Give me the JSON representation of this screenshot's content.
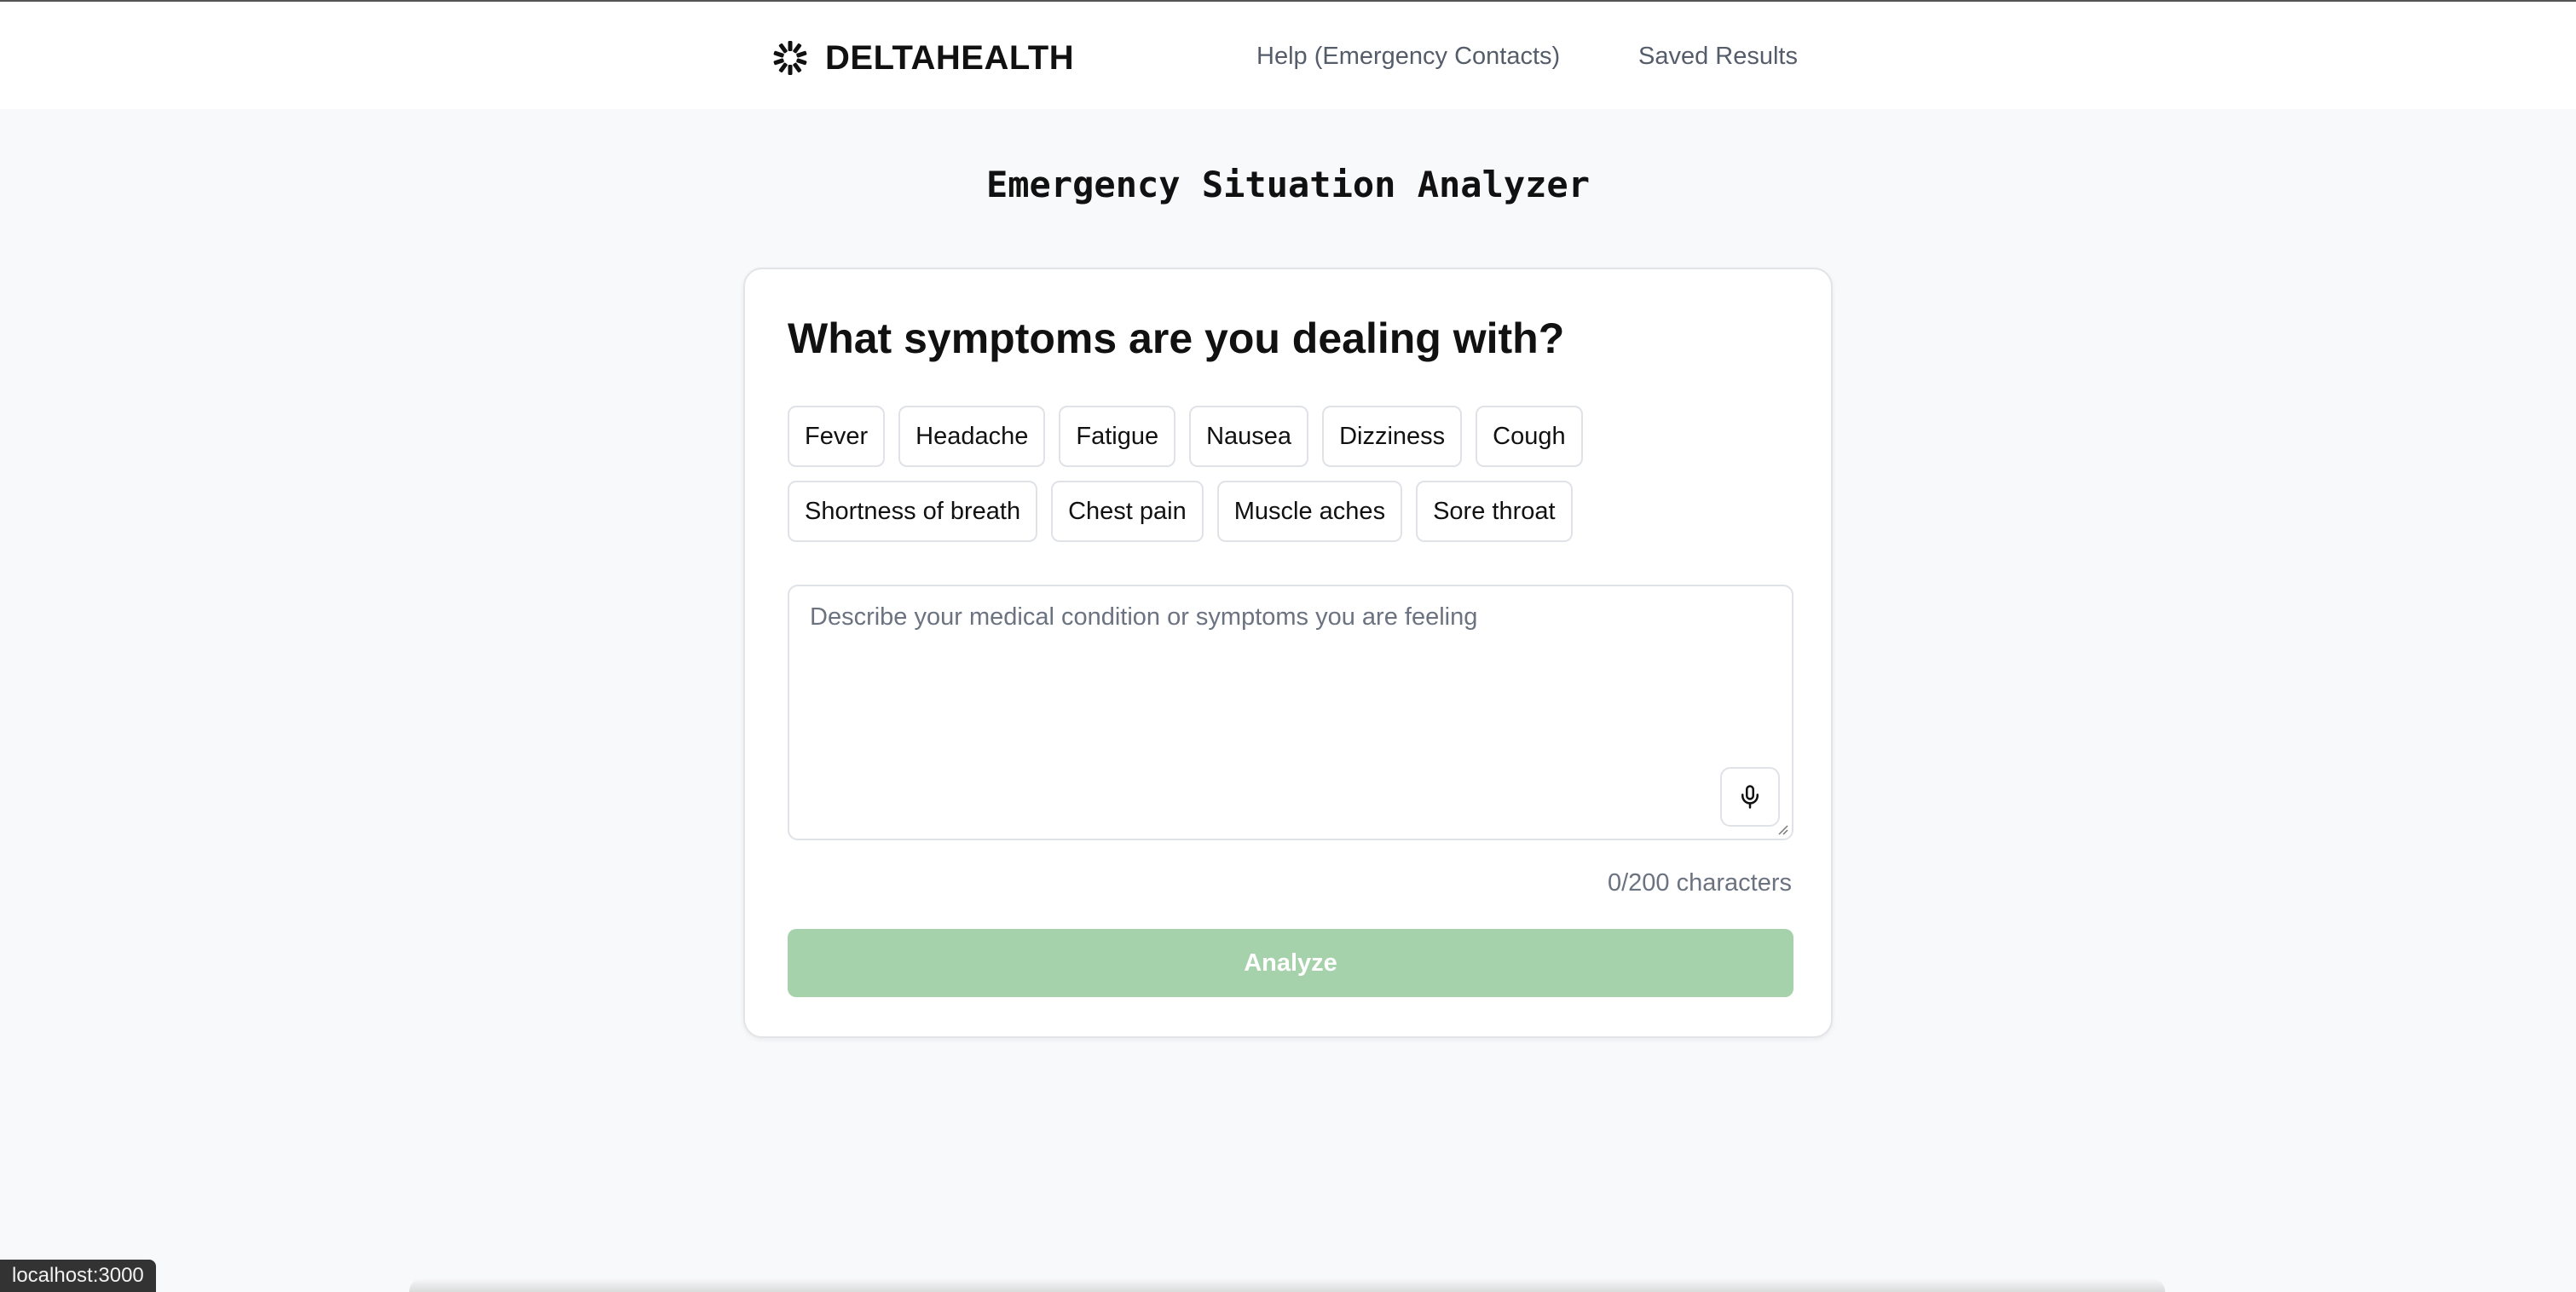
{
  "navbar": {
    "brand": "DELTAHEALTH",
    "brand_icon": "sparkle-burst-icon",
    "links": {
      "help": "Help (Emergency Contacts)",
      "saved": "Saved Results"
    }
  },
  "page": {
    "title": "Emergency Situation Analyzer"
  },
  "form": {
    "heading": "What symptoms are you dealing with?",
    "chips": [
      "Fever",
      "Headache",
      "Fatigue",
      "Nausea",
      "Dizziness",
      "Cough",
      "Shortness of breath",
      "Chest pain",
      "Muscle aches",
      "Sore throat"
    ],
    "textarea": {
      "value": "",
      "placeholder": "Describe your medical condition or symptoms you are feeling"
    },
    "mic_icon": "microphone-icon",
    "char_count": "0/200 characters",
    "analyze_label": "Analyze",
    "analyze_color": "#a5d1ab"
  },
  "status_bar": {
    "url": "localhost:3000"
  }
}
